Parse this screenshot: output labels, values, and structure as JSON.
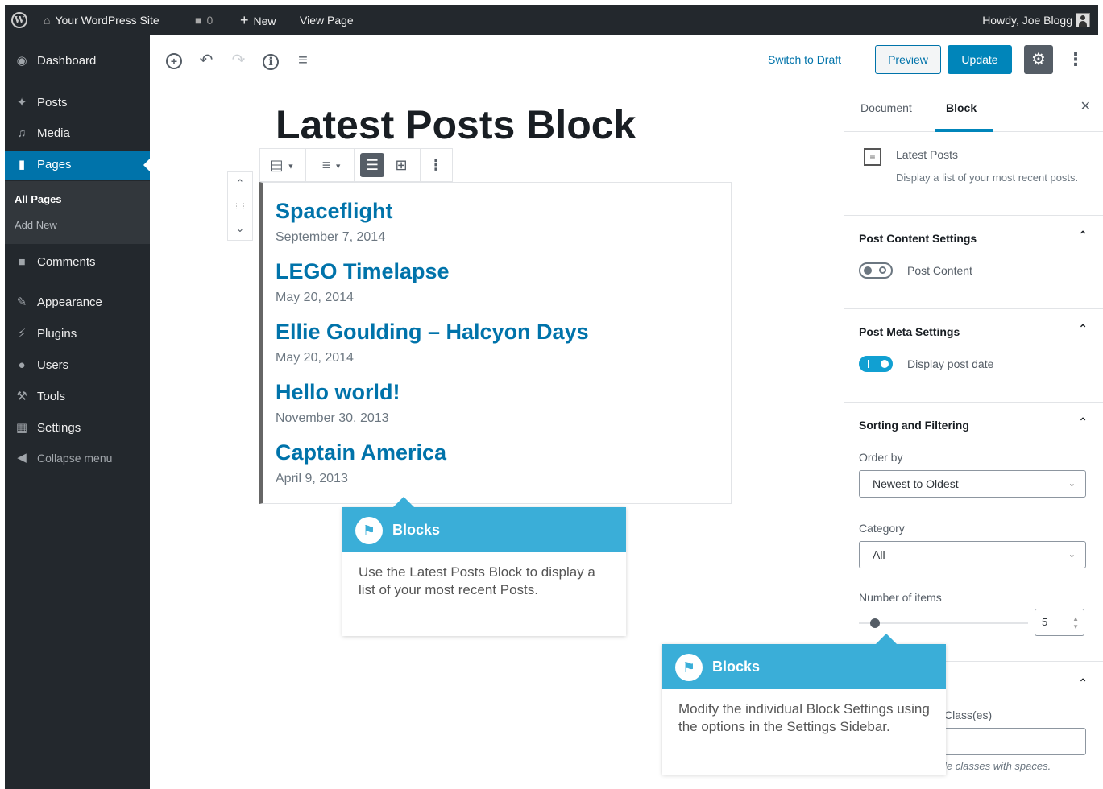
{
  "admin_bar": {
    "wp_logo": "W",
    "site_name": "Your WordPress Site",
    "comments_count": "0",
    "new_label": "New",
    "view_page_label": "View Page",
    "howdy": "Howdy, Joe Blogg"
  },
  "menu": {
    "dashboard": "Dashboard",
    "posts": "Posts",
    "media": "Media",
    "pages": "Pages",
    "all_pages": "All Pages",
    "add_new": "Add New",
    "comments": "Comments",
    "appearance": "Appearance",
    "plugins": "Plugins",
    "users": "Users",
    "tools": "Tools",
    "settings": "Settings",
    "collapse": "Collapse menu"
  },
  "toolbar": {
    "switch_to_draft": "Switch to Draft",
    "preview": "Preview",
    "update": "Update"
  },
  "post": {
    "title": "Latest Posts Block"
  },
  "latest_posts": [
    {
      "title": "Spaceflight",
      "date": "September 7, 2014"
    },
    {
      "title": "LEGO Timelapse",
      "date": "May 20, 2014"
    },
    {
      "title": "Ellie Goulding – Halcyon Days",
      "date": "May 20, 2014"
    },
    {
      "title": "Hello world!",
      "date": "November 30, 2013"
    },
    {
      "title": "Captain America",
      "date": "April 9, 2013"
    }
  ],
  "callouts": [
    {
      "title": "Blocks",
      "body": "Use the Latest Posts Block to display a list of your most recent Posts."
    },
    {
      "title": "Blocks",
      "body": "Modify the individual Block Settings using the options in the Settings Sidebar."
    }
  ],
  "sidebar": {
    "tab_document": "Document",
    "tab_block": "Block",
    "block_name": "Latest Posts",
    "block_description": "Display a list of your most recent posts.",
    "post_content_settings": {
      "title": "Post Content Settings",
      "toggle_label": "Post Content",
      "toggle_on": false
    },
    "post_meta_settings": {
      "title": "Post Meta Settings",
      "toggle_label": "Display post date",
      "toggle_on": true
    },
    "sorting": {
      "title": "Sorting and Filtering",
      "order_by_label": "Order by",
      "order_by_value": "Newest to Oldest",
      "category_label": "Category",
      "category_value": "All",
      "number_label": "Number of items",
      "number_value": "5"
    },
    "advanced": {
      "classes_label": "Class(es)",
      "help_text": "le classes with spaces."
    }
  },
  "colors": {
    "admin_dark": "#23282d",
    "primary_blue": "#0073aa",
    "update_button": "#0085ba",
    "callout_header": "#3aaed8",
    "toggle_on": "#11a0d2"
  }
}
